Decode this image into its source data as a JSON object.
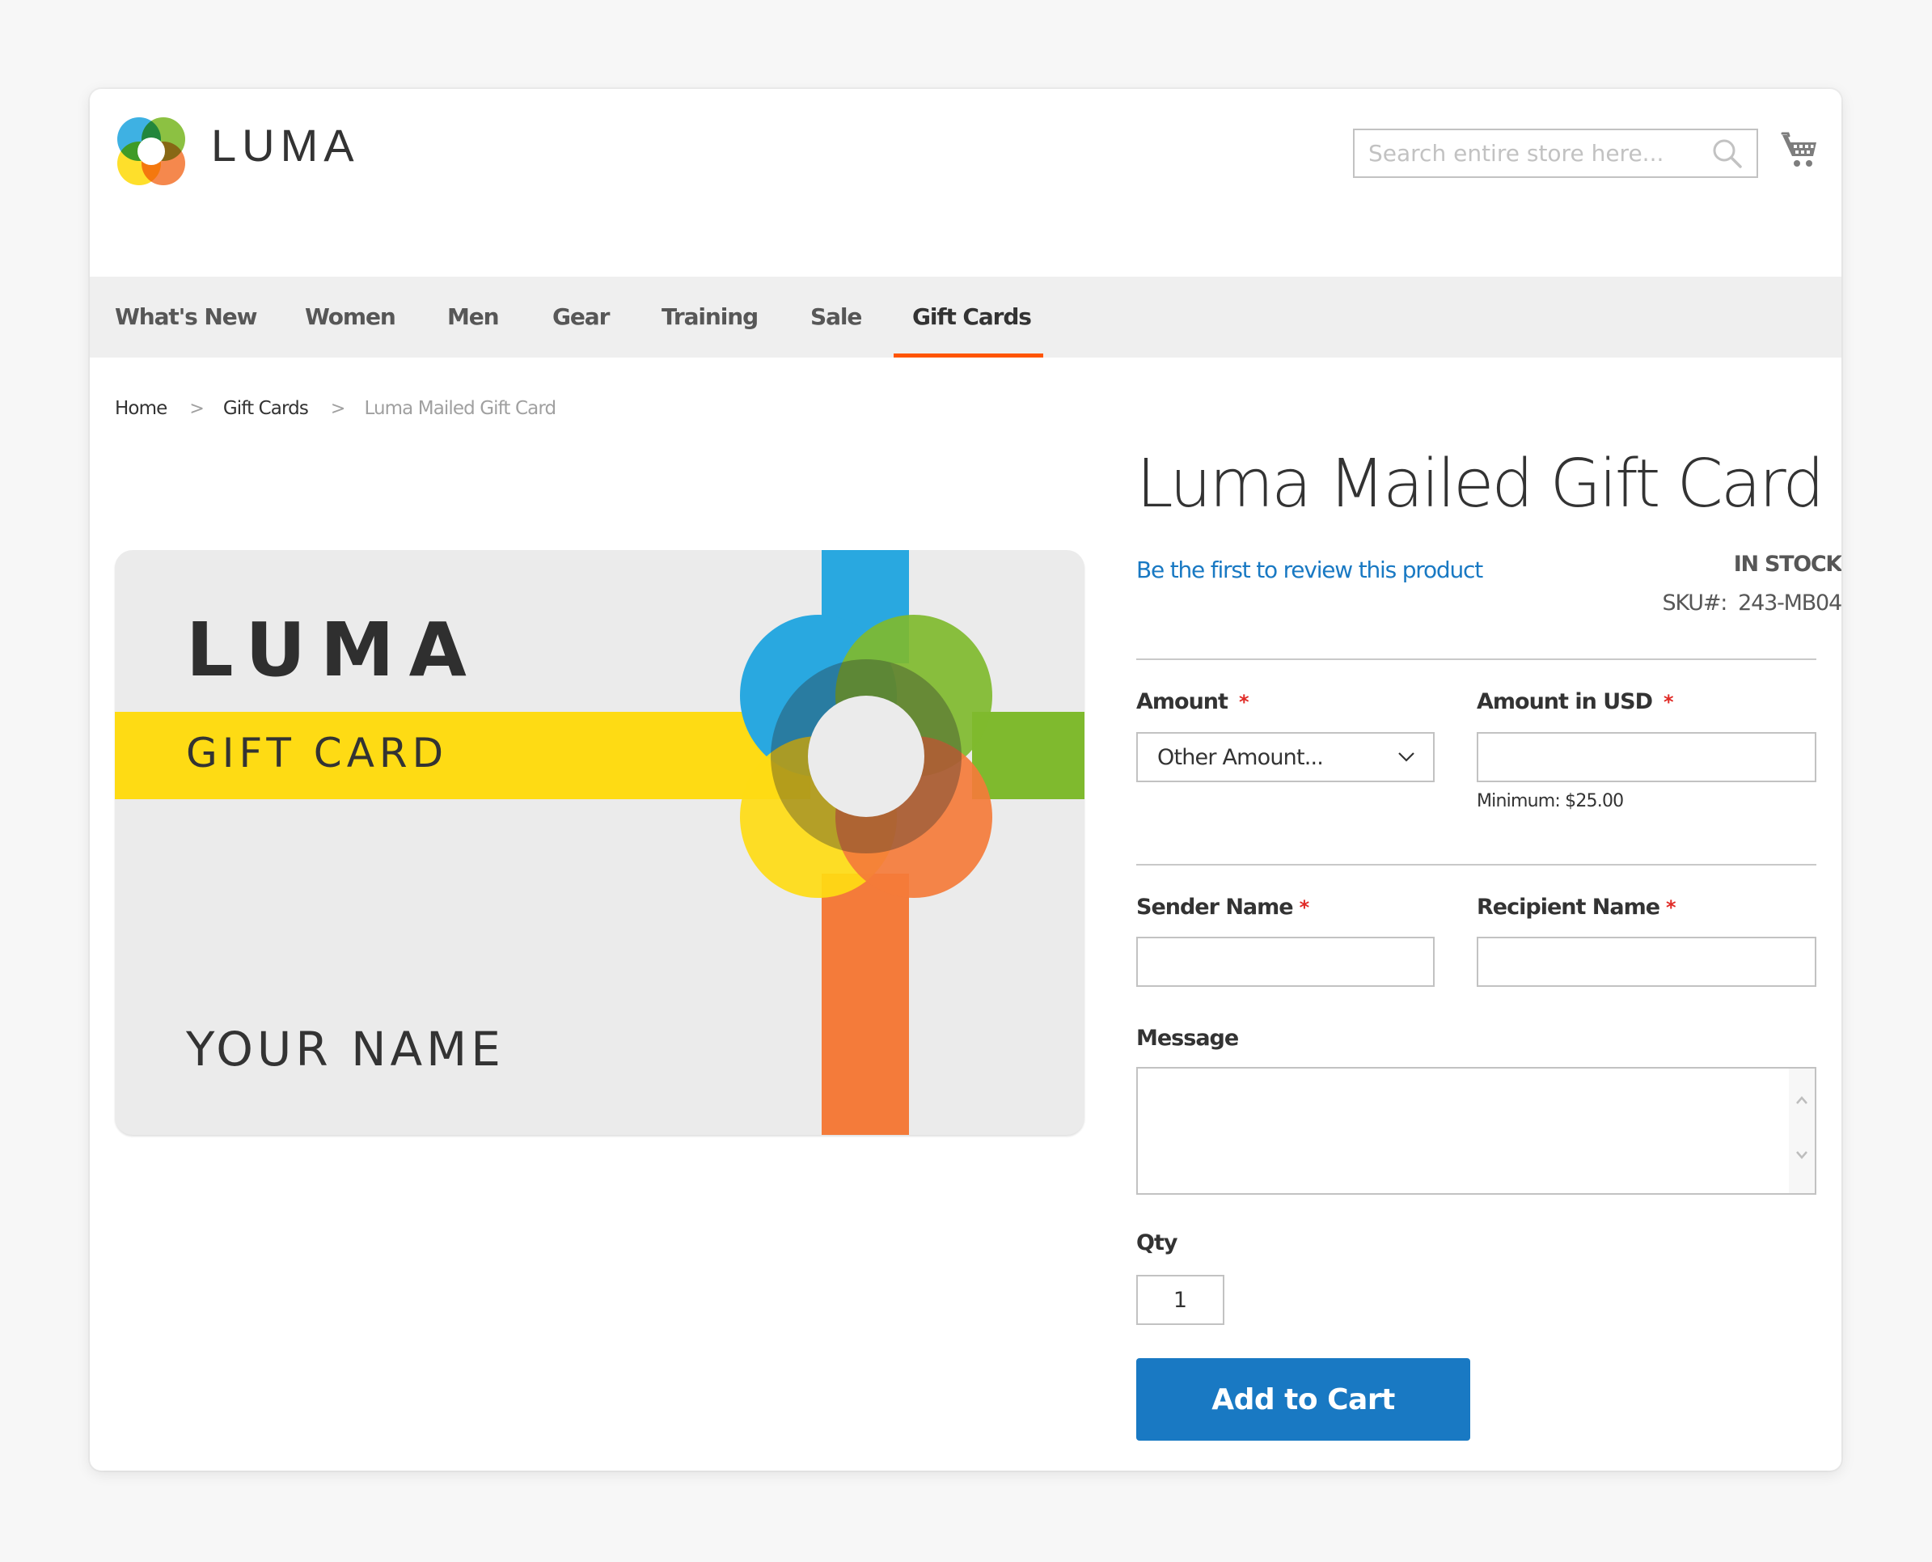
{
  "header": {
    "brand": "LUMA",
    "search": {
      "placeholder": "Search entire store here...",
      "value": ""
    },
    "cart_icon": "shopping-cart-icon",
    "search_icon": "magnifier-icon"
  },
  "nav": {
    "items": [
      {
        "label": "What's New",
        "active": false
      },
      {
        "label": "Women",
        "active": false
      },
      {
        "label": "Men",
        "active": false
      },
      {
        "label": "Gear",
        "active": false
      },
      {
        "label": "Training",
        "active": false
      },
      {
        "label": "Sale",
        "active": false
      },
      {
        "label": "Gift Cards",
        "active": true
      }
    ],
    "active_color": "#ff5501"
  },
  "breadcrumb": {
    "items": [
      "Home",
      "Gift Cards"
    ],
    "current": "Luma Mailed Gift Card",
    "separator": ">"
  },
  "product": {
    "title": "Luma Mailed Gift Card",
    "review_link": "Be the first to review this product",
    "stock": "IN STOCK",
    "sku_label": "SKU#:",
    "sku": "243-MB04",
    "image": {
      "brand": "LUMA",
      "subtitle": "GIFT CARD",
      "name_text": "YOUR NAME",
      "colors": {
        "blue": "#29a8e0",
        "green": "#7fba2e",
        "yellow": "#fedb14",
        "orange": "#f47b3a",
        "bg": "#ebebeb"
      }
    }
  },
  "form": {
    "amount": {
      "label": "Amount",
      "required": "*",
      "selected": "Other Amount..."
    },
    "amount_usd": {
      "label": "Amount in USD",
      "required": "*",
      "value": "",
      "note": "Minimum: $25.00"
    },
    "sender": {
      "label": "Sender Name",
      "required": "*",
      "value": ""
    },
    "recipient": {
      "label": "Recipient Name",
      "required": "*",
      "value": ""
    },
    "message": {
      "label": "Message",
      "value": ""
    },
    "qty": {
      "label": "Qty",
      "value": "1"
    },
    "submit_label": "Add to Cart"
  },
  "colors": {
    "link": "#1979c3",
    "primary_button": "#1979c3",
    "required": "#e02b27"
  }
}
